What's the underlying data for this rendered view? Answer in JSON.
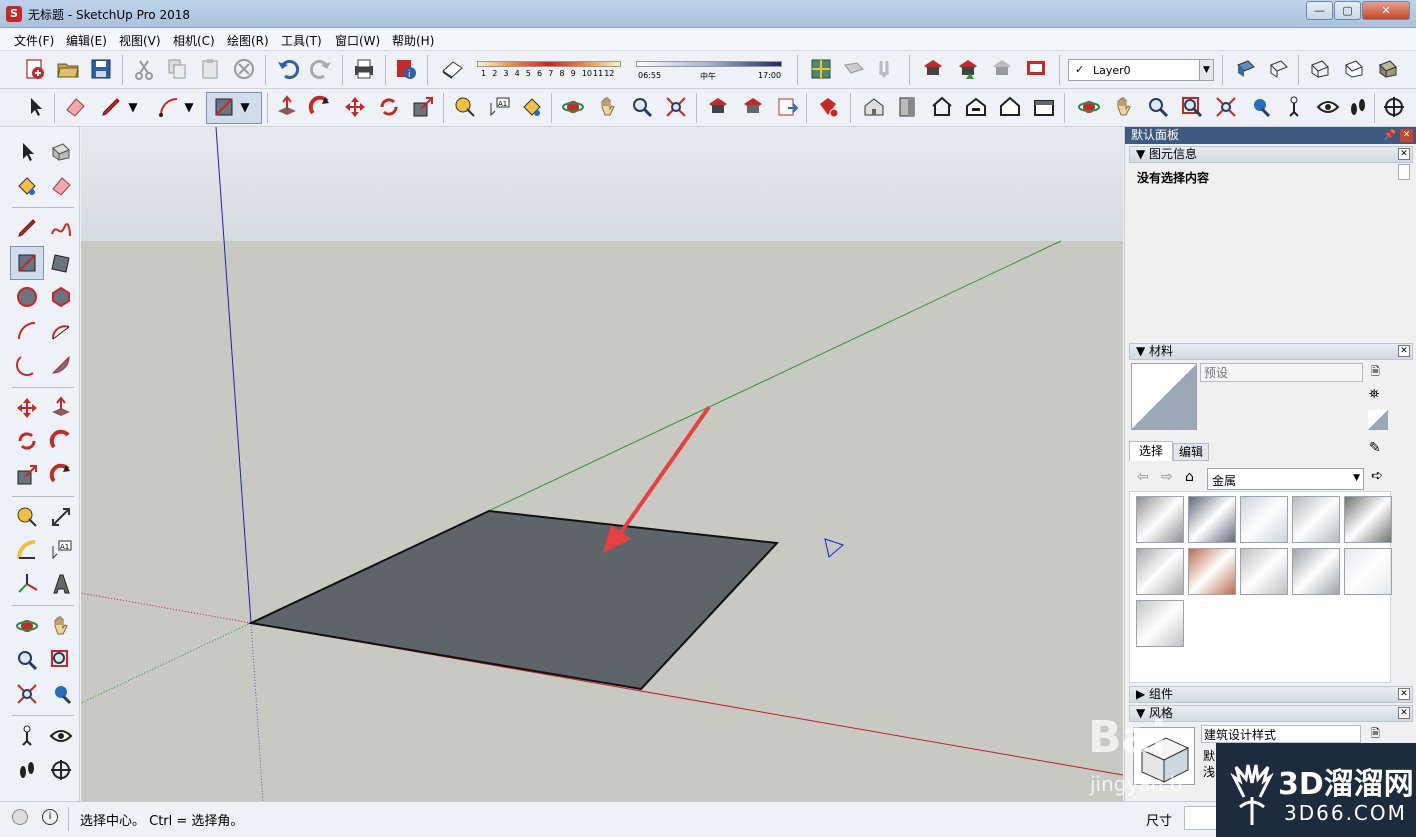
{
  "window": {
    "title": "无标题 - SketchUp Pro 2018",
    "app_icon": "sketchup-icon"
  },
  "menu": [
    "文件(F)",
    "编辑(E)",
    "视图(V)",
    "相机(C)",
    "绘图(R)",
    "工具(T)",
    "窗口(W)",
    "帮助(H)"
  ],
  "shadow": {
    "months": [
      "1",
      "2",
      "3",
      "4",
      "5",
      "6",
      "7",
      "8",
      "9",
      "10",
      "11",
      "12"
    ],
    "time_start": "06:55",
    "time_mid": "中午",
    "time_end": "17:00"
  },
  "layer": {
    "selected": "Layer0",
    "check": "✓"
  },
  "tray": {
    "title": "默认面板",
    "entity_info": {
      "header": "图元信息",
      "message": "没有选择内容"
    },
    "materials": {
      "header": "材料",
      "name_placeholder": "预设",
      "tab_select": "选择",
      "tab_edit": "编辑",
      "collection": "金属",
      "swatch_colors": [
        "#8f8f8f",
        "#5f6a78",
        "#c9d3dc",
        "#b4b8bc",
        "#70726e",
        "#a8a8a8",
        "#b76e4f",
        "#bfbfbf",
        "#9ea2a6",
        "#e6e7e9",
        "#c3c3c3"
      ]
    },
    "components": {
      "header": "组件"
    },
    "styles": {
      "header": "风格",
      "style_name": "建筑设计样式",
      "line1": "默",
      "line2": "浅"
    }
  },
  "status": {
    "message": "选择中心。 Ctrl = 选择角。",
    "measure_label": "尺寸"
  },
  "watermark": {
    "brand": "3D溜溜网",
    "url": "3D66.COM",
    "baidu": "Bai",
    "jingyan": "jingyan.b"
  },
  "colors": {
    "sky": "#e2e6ea",
    "ground": "#c9c9c4",
    "face": "#5f6469",
    "axis_red": "#c02020",
    "axis_green": "#2a9a2a",
    "axis_blue": "#2020b0",
    "arrow": "#e84040"
  }
}
